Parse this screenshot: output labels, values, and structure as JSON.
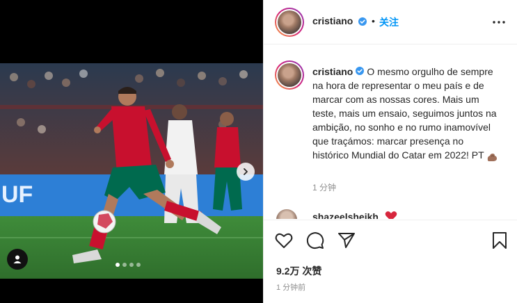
{
  "post": {
    "username": "cristiano",
    "follow_label": "关注",
    "bullet": "•",
    "caption": "O mesmo orgulho de sempre na hora de representar o meu país e de marcar com as nossas cores. Mais um teste, mais um ensaio, seguimos juntos na ambição, no sonho e no rumo inamovível que traçámos: marcar presença no histórico Mundial do Catar em 2022! PT",
    "caption_time": "1 分钟",
    "likes": "9.2万 次赞",
    "posted_ago": "1 分钟前",
    "carousel": {
      "current": 1,
      "total": 4
    }
  },
  "comments": [
    {
      "username": "shazeelsheikh"
    }
  ],
  "icons": {
    "verified": "verified-badge-icon",
    "more": "more-options-icon",
    "like": "heart-outline-icon",
    "comment": "comment-bubble-icon",
    "share": "paper-plane-icon",
    "save": "bookmark-icon",
    "next": "chevron-right-icon",
    "user_tag": "user-tag-icon"
  },
  "colors": {
    "accent": "#0095f6",
    "verified": "#3897f0",
    "text": "#262626",
    "secondary": "#8e8e8e",
    "kit_red": "#c8102e",
    "kit_green": "#006a4e"
  }
}
